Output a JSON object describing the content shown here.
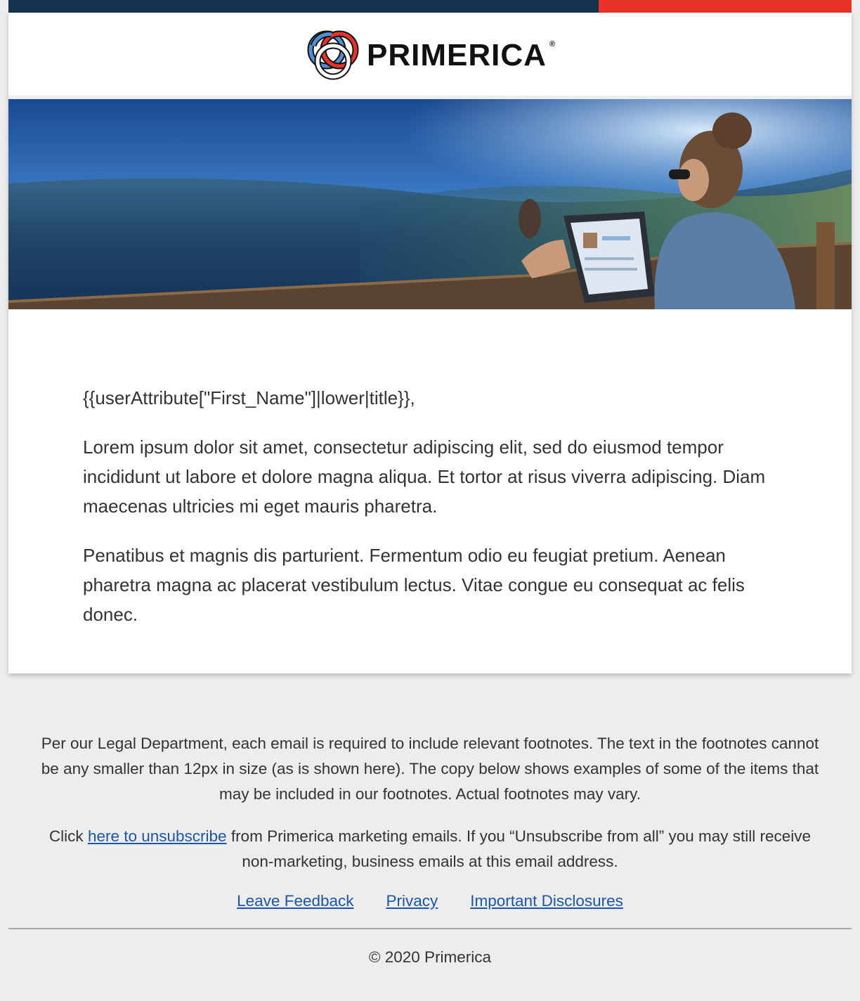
{
  "brand": {
    "name": "PRIMERICA",
    "registered_mark": "®",
    "colors": {
      "navy": "#17324d",
      "red": "#e8332a",
      "link": "#1a55b0"
    }
  },
  "hero": {
    "image": "woman-with-laptop-scenic-view",
    "alt": "Woman relaxing with laptop overlooking landscape"
  },
  "body": {
    "greeting": "{{userAttribute[\"First_Name\"]|lower|title}},",
    "paragraphs": [
      "Lorem ipsum dolor sit amet, consectetur adipiscing elit, sed do eiusmod tempor incididunt ut labore et dolore magna aliqua. Et tortor at risus viverra adipiscing. Diam maecenas ultricies mi eget mauris pharetra.",
      "Penatibus et magnis dis parturient. Fermentum odio eu feugiat pretium. Aenean pharetra magna ac placerat vestibulum lectus. Vitae congue eu consequat ac felis donec."
    ]
  },
  "footer": {
    "legal": "Per our Legal Department, each email is required to include relevant footnotes. The text in the footnotes cannot be any smaller than 12px in size (as is shown here). The copy below shows examples of some of the items that may be included in our footnotes. Actual footnotes may vary.",
    "unsub_prefix": "Click ",
    "unsub_link": "here to unsubscribe",
    "unsub_suffix": " from Primerica marketing emails. If you “Unsubscribe from all” you may still receive non-marketing, business emails at this email address.",
    "links": {
      "feedback": "Leave Feedback",
      "privacy": "Privacy",
      "disclosures": "Important Disclosures"
    },
    "copyright": "© 2020 Primerica"
  }
}
